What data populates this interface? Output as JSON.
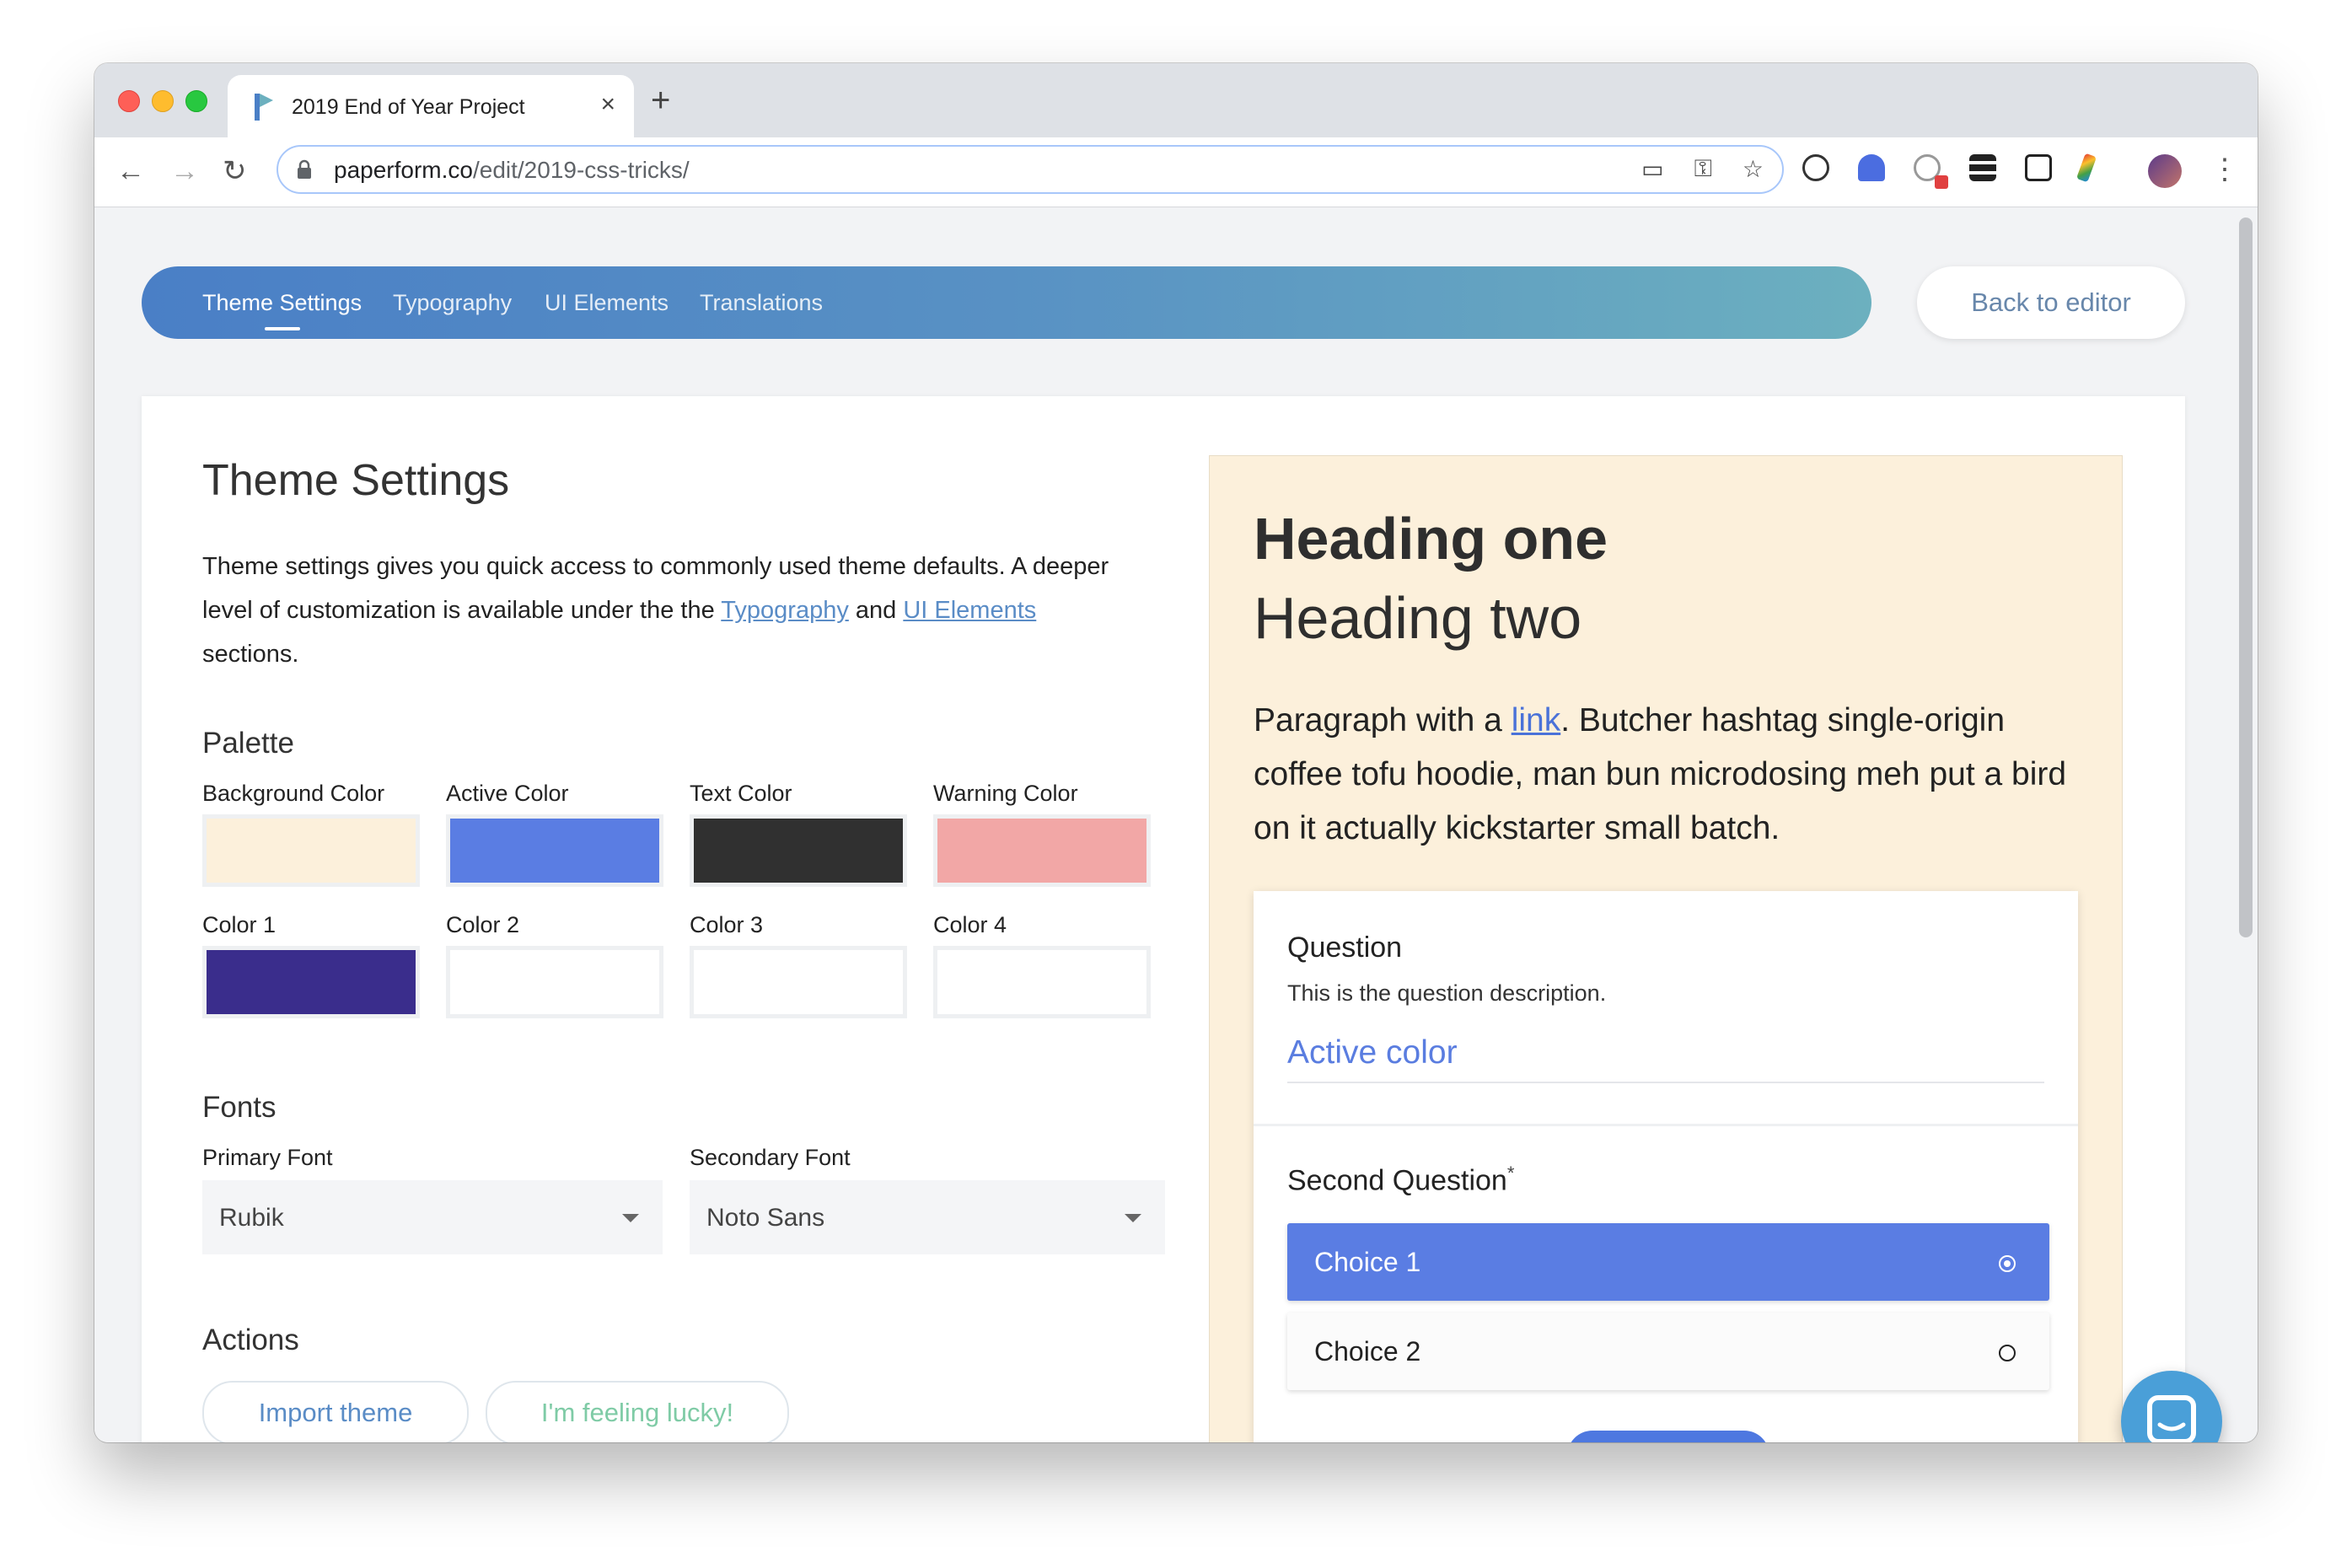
{
  "browser": {
    "tab_title": "2019 End of Year Project",
    "tab_close": "×",
    "new_tab": "+",
    "url_host": "paperform.co",
    "url_path": "/edit/2019-css-tricks/"
  },
  "nav": {
    "tabs": [
      {
        "label": "Theme Settings"
      },
      {
        "label": "Typography"
      },
      {
        "label": "UI Elements"
      },
      {
        "label": "Translations"
      }
    ],
    "back_label": "Back to editor"
  },
  "settings": {
    "title": "Theme Settings",
    "desc_part1": "Theme settings gives you quick access to commonly used theme defaults. A deeper level of customization is available under the the ",
    "link_typography": "Typography",
    "desc_and": " and ",
    "link_ui": "UI Elements",
    "desc_part2": " sections.",
    "palette_title": "Palette",
    "swatches": [
      {
        "label": "Background Color",
        "color": "#fcf0db"
      },
      {
        "label": "Active Color",
        "color": "#5a7de3"
      },
      {
        "label": "Text Color",
        "color": "#303030"
      },
      {
        "label": "Warning Color",
        "color": "#f2a7a6"
      },
      {
        "label": "Color 1",
        "color": "#3a2d8c"
      },
      {
        "label": "Color 2",
        "color": "#ffffff"
      },
      {
        "label": "Color 3",
        "color": "#ffffff"
      },
      {
        "label": "Color 4",
        "color": "#ffffff"
      }
    ],
    "fonts_title": "Fonts",
    "primary_font_label": "Primary Font",
    "primary_font_value": "Rubik",
    "secondary_font_label": "Secondary Font",
    "secondary_font_value": "Noto Sans",
    "actions_title": "Actions",
    "import_label": "Import theme",
    "lucky_label": "I'm feeling lucky!"
  },
  "preview": {
    "heading_one": "Heading one",
    "heading_two": "Heading two",
    "para_start": "Paragraph with a ",
    "para_link": "link",
    "para_end": ". Butcher hashtag single-origin coffee tofu hoodie, man bun microdosing meh put a bird on it actually kickstarter small batch.",
    "question_title": "Question",
    "question_desc": "This is the question description.",
    "question_input": "Active color",
    "second_question": "Second Question",
    "required_mark": "*",
    "choices": [
      {
        "label": "Choice 1"
      },
      {
        "label": "Choice 2"
      }
    ]
  },
  "colors": {
    "accent": "#5a7de3",
    "nav_gradient_start": "#4a7fc6",
    "nav_gradient_end": "#6cb0bf",
    "preview_background": "#fcf0db"
  }
}
